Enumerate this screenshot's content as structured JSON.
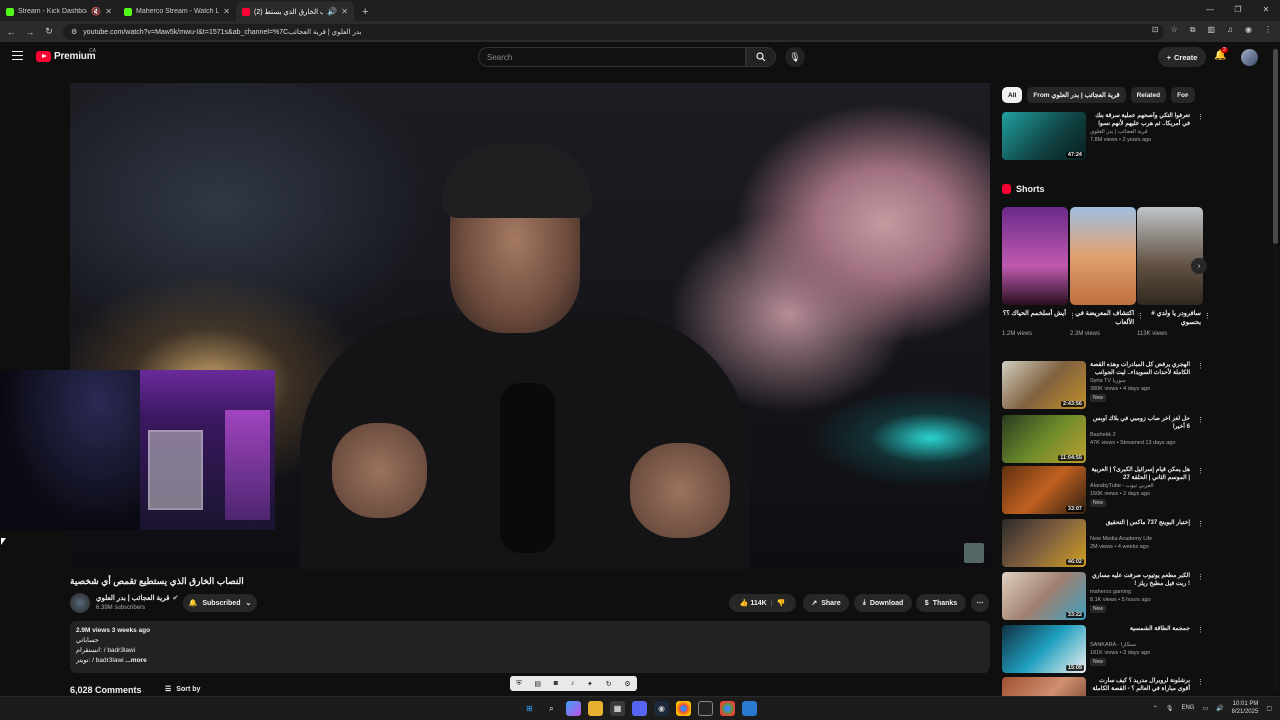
{
  "browser": {
    "tabs": [
      {
        "title": "Stream - Kick Dashboard",
        "color": "#53fc18"
      },
      {
        "title": "Maherco Stream - Watch Live o",
        "color": "#53fc18"
      },
      {
        "title": "(2) النصاب الخارق الذي يستط",
        "color": "#ff0033"
      }
    ],
    "url": "youtube.com/watch?v=Maw5k/mwu-I&t=1571s&ab_channel=%7Cبدر العلوي | قرية العجائب"
  },
  "header": {
    "logo": "Premium",
    "country": "CA",
    "search_placeholder": "Search",
    "create_label": "Create",
    "notif_count": "2"
  },
  "video": {
    "title": "النصاب الخارق الذي يستطيع تقمص أي شخصية",
    "channel": "قرية العجائب | بدر العلوي",
    "subscribers": "6.39M subscribers",
    "subscribed_label": "Subscribed",
    "likes": "114K",
    "share_label": "Share",
    "download_label": "Download",
    "thanks_label": "Thanks",
    "description": {
      "meta": "2.9M views  3 weeks ago",
      "line1": "حساباتي",
      "line2": "انستقرام:  / badr3lawi",
      "line3": "تويتر:  / badr3lawi",
      "more": "...more"
    },
    "comments_count": "6,028 Comments",
    "sort_label": "Sort by"
  },
  "sidebar": {
    "chips": [
      "All",
      "From قرية العجائب | بدر العلوي",
      "Related",
      "For"
    ],
    "first": {
      "title": "تعرفوا آلتكي وأصحهم عملية سرقة بنك في أمريكا.. ثم هرب عليهم لأنهم نسوا الشغل!",
      "channel": "قرية العجائب | بدر العلوي",
      "meta": "7.8M views • 2 years ago",
      "duration": "47:24"
    },
    "shorts_title": "Shorts",
    "shorts": [
      {
        "title": "أيش أسلخمم الحياك ؟؟",
        "views": "1.2M views"
      },
      {
        "title": "اكتشاف المعريضة في الألعاب",
        "views": "2.3M views"
      },
      {
        "title": "سافرودر يا ولدي # بحسوي",
        "views": "113K views"
      }
    ],
    "recs": [
      {
        "title": "الهجري يرفض كل المبادرات وهذه القصة الكاملة لأحداث السويداء.. ليت الجوانب",
        "channel": "Syria TV سوريا",
        "meta": "380K views • 4 days ago",
        "badge": "New",
        "duration": "2:43:56"
      },
      {
        "title": "حل لغز آخر صاب زومبي في بلاك أوبس 6 أخيرا",
        "channel": "Bashekk 2",
        "meta": "47K views • Streamed 13 days ago",
        "badge": "",
        "duration": "11:04:55"
      },
      {
        "title": "هل يمكن قيام إسرائيل الكبرى؟ | العربية | الموسم الثاني | الحلقة 27",
        "channel": "AlarabyTube - العربي تيوب",
        "meta": "150K views • 2 days ago",
        "badge": "New",
        "duration": "33:07"
      },
      {
        "title": "إختبار البوينج 737 ماكس | التحقيق",
        "channel": "New Media Academy Life",
        "meta": "2M views • 4 weeks ago",
        "badge": "",
        "duration": "46:02"
      },
      {
        "title": "الكبر مطعم يوتيوب صرفت عليه مساري ! ريت فيل مطبخ ريلز !",
        "channel": "maherco gaming",
        "meta": "8.1K views • 5 hours ago",
        "badge": "New",
        "duration": "33:22"
      },
      {
        "title": "جمجمة الطاقة الشمسية",
        "channel": "SANKARA - سنكارا",
        "meta": "181K views • 3 days ago",
        "badge": "New",
        "duration": "15:09"
      },
      {
        "title": "برشلونة لروبرال مدريد ؟ كيف سارت أقوى مباراة في العالم ؟ - القصة الكاملة",
        "channel": "",
        "meta": "",
        "badge": "",
        "duration": ""
      }
    ]
  },
  "taskbar": {
    "lang": "ENG",
    "time": "10:01 PM",
    "date": "8/21/2025"
  }
}
